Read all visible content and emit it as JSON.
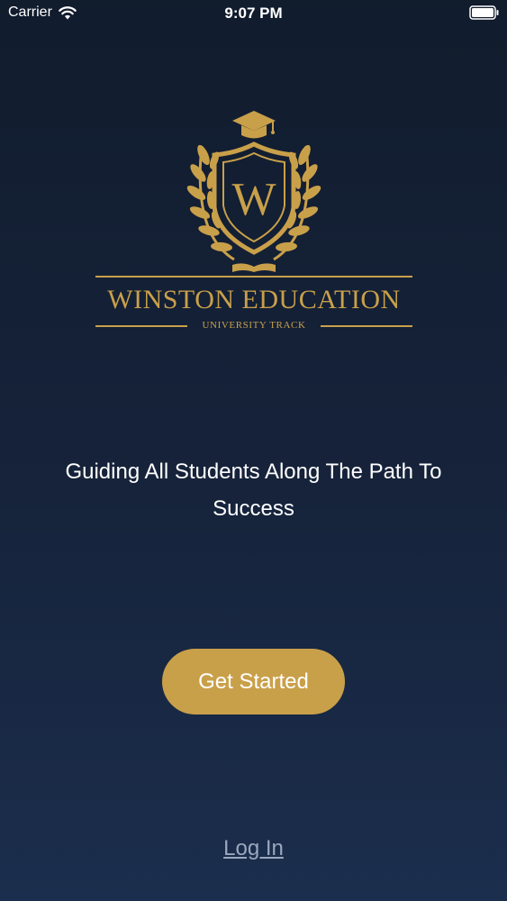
{
  "status_bar": {
    "carrier": "Carrier",
    "time": "9:07 PM",
    "wifi_icon": "wifi-icon",
    "battery_icon": "battery-icon"
  },
  "logo": {
    "brand_name": "WINSTON EDUCATION",
    "subtitle": "UNIVERSITY TRACK",
    "monogram": "W",
    "accent_color": "#c9a04a"
  },
  "tagline": "Guiding All Students Along The Path To Success",
  "actions": {
    "primary_label": "Get Started",
    "secondary_label": "Log In"
  },
  "colors": {
    "background_top": "#111c2d",
    "background_bottom": "#1b2e4d",
    "accent": "#c9a04a",
    "link": "#9aa7bd"
  }
}
